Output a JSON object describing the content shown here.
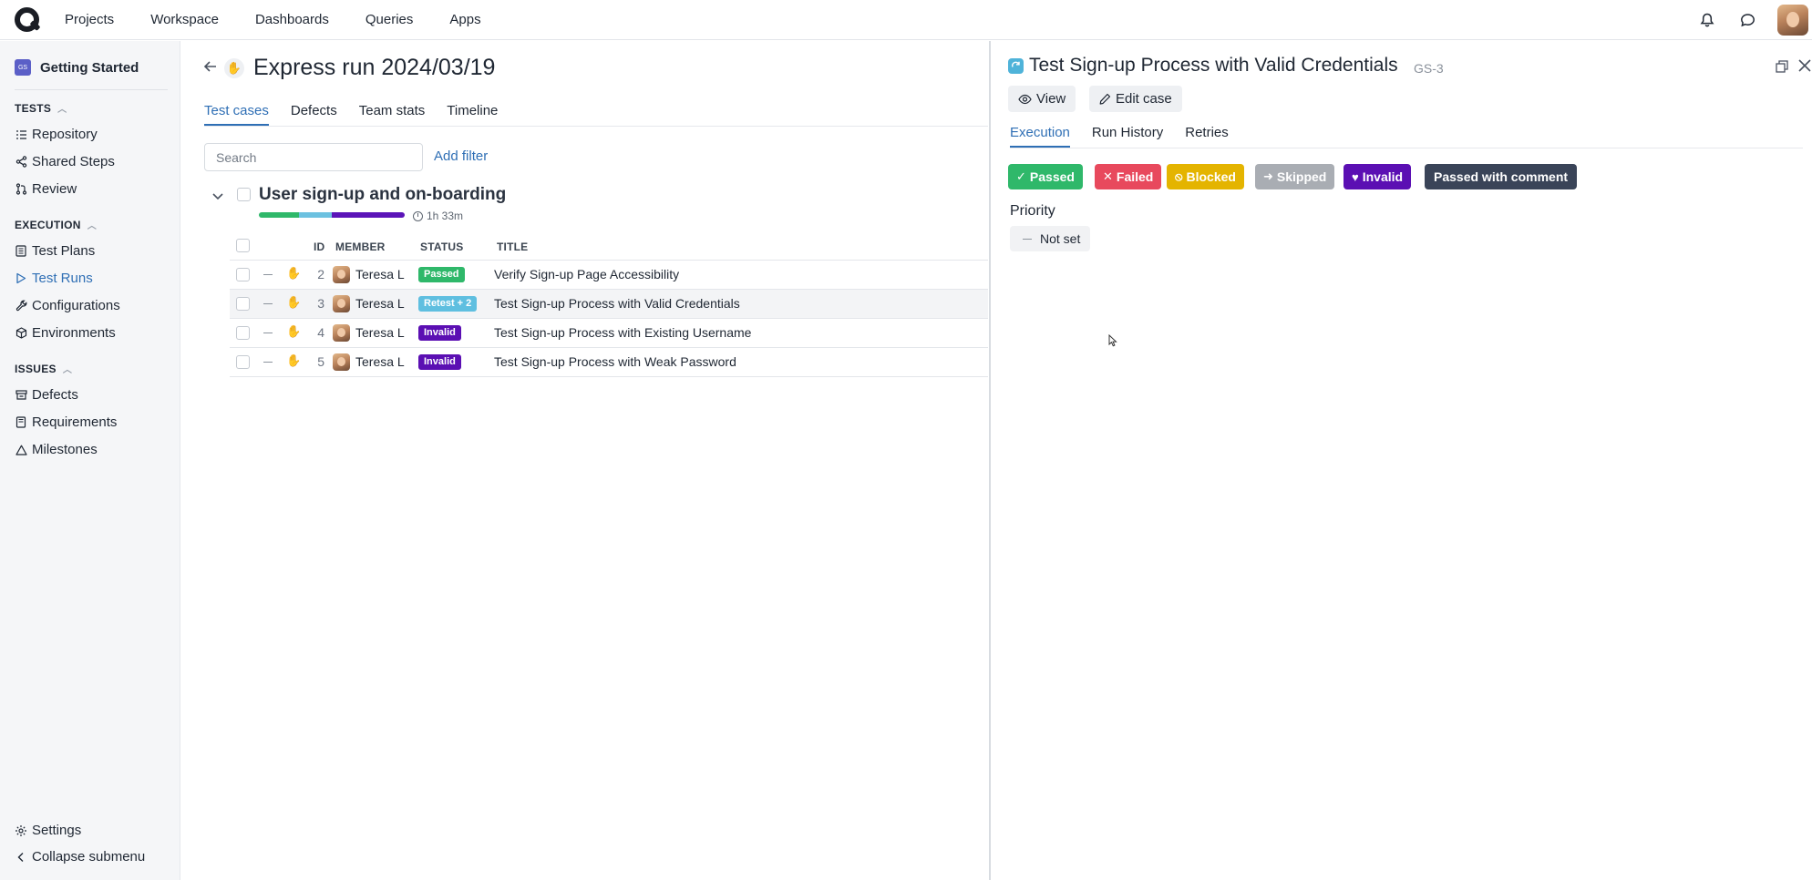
{
  "topnav": {
    "items": [
      "Projects",
      "Workspace",
      "Dashboards",
      "Queries",
      "Apps"
    ]
  },
  "sidebar": {
    "project_badge": "GS",
    "project_name": "Getting Started",
    "sections": [
      {
        "title": "TESTS",
        "items": [
          "Repository",
          "Shared Steps",
          "Review"
        ]
      },
      {
        "title": "EXECUTION",
        "items": [
          "Test Plans",
          "Test Runs",
          "Configurations",
          "Environments"
        ]
      },
      {
        "title": "ISSUES",
        "items": [
          "Defects",
          "Requirements",
          "Milestones"
        ]
      }
    ],
    "active_item": "Test Runs",
    "footer": {
      "settings": "Settings",
      "collapse": "Collapse submenu"
    }
  },
  "run": {
    "title": "Express run 2024/03/19",
    "tabs": [
      "Test cases",
      "Defects",
      "Team stats",
      "Timeline"
    ],
    "active_tab": "Test cases",
    "search_placeholder": "Search",
    "add_filter": "Add filter",
    "group": {
      "title": "User sign-up and on-boarding",
      "duration": "1h 33m",
      "progress_colors": [
        "#2fb86a",
        "#6cc1e0",
        "#5b14b8"
      ]
    },
    "columns": {
      "id": "ID",
      "member": "MEMBER",
      "status": "STATUS",
      "title": "TITLE"
    },
    "rows": [
      {
        "id": "2",
        "member": "Teresa L",
        "status": "Passed",
        "status_color": "#2fb86a",
        "title": "Verify Sign-up Page Accessibility"
      },
      {
        "id": "3",
        "member": "Teresa L",
        "status": "Retest + 2",
        "status_color": "#5fbfe0",
        "title": "Test Sign-up Process with Valid Credentials"
      },
      {
        "id": "4",
        "member": "Teresa L",
        "status": "Invalid",
        "status_color": "#5b0fb3",
        "title": "Test Sign-up Process with Existing Username"
      },
      {
        "id": "5",
        "member": "Teresa L",
        "status": "Invalid",
        "status_color": "#5b0fb3",
        "title": "Test Sign-up Process with Weak Password"
      }
    ]
  },
  "panel": {
    "title": "Test Sign-up Process with Valid Credentials",
    "code": "GS-3",
    "view_label": "View",
    "edit_label": "Edit case",
    "tabs": [
      "Execution",
      "Run History",
      "Retries"
    ],
    "active_tab": "Execution",
    "status_buttons": [
      {
        "label": "Passed",
        "color": "#2fb86a",
        "glyph": "✓"
      },
      {
        "label": "Failed",
        "color": "#e8495d",
        "glyph": "✕"
      },
      {
        "label": "Blocked",
        "color": "#e4b400",
        "glyph": "⦸"
      },
      {
        "label": "Skipped",
        "color": "#a9adb3",
        "glyph": "➜"
      },
      {
        "label": "Invalid",
        "color": "#5b0fb3",
        "glyph": "♥"
      },
      {
        "label": "Passed with comment",
        "color": "#3a4458",
        "glyph": ""
      }
    ],
    "priority_label": "Priority",
    "priority_value": "Not set"
  }
}
